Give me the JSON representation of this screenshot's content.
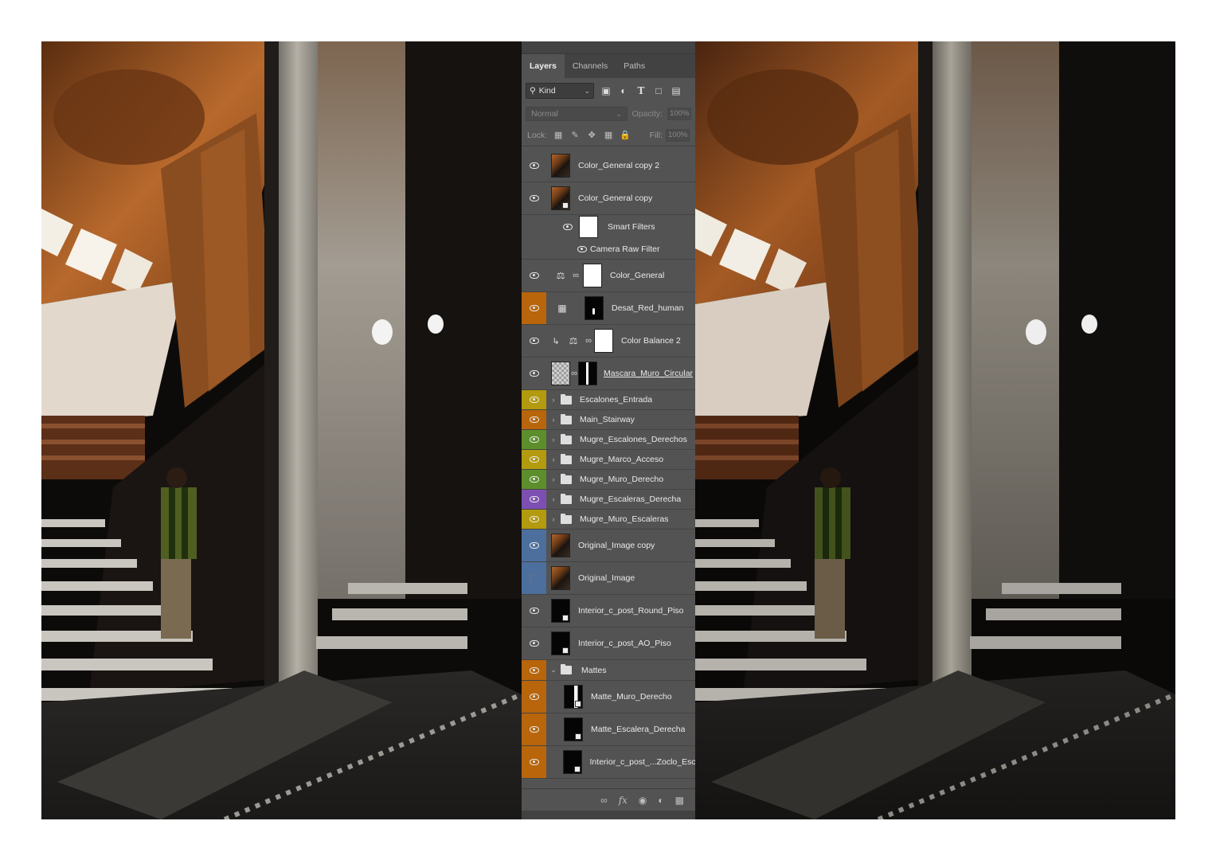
{
  "panel": {
    "tabs": [
      {
        "label": "Layers",
        "active": true
      },
      {
        "label": "Channels",
        "active": false
      },
      {
        "label": "Paths",
        "active": false
      }
    ],
    "filter": {
      "kind_label": "Kind",
      "icons": [
        "image-filter-icon",
        "adjustment-filter-icon",
        "type-filter-icon",
        "shape-filter-icon",
        "smart-object-filter-icon"
      ]
    },
    "blend_mode": "Normal",
    "opacity_label": "Opacity:",
    "opacity_value": "100%",
    "lock_label": "Lock:",
    "fill_label": "Fill:",
    "fill_value": "100%",
    "colors": {
      "orange": "#b8650b",
      "yellow": "#b39a0e",
      "green": "#5c8f2b",
      "purple": "#7d4fb3",
      "blue": "#4d6f9e",
      "panel": "#535353"
    }
  },
  "layers": [
    {
      "name": "Color_General copy 2",
      "kind": "smart"
    },
    {
      "name": "Color_General copy",
      "kind": "smart"
    },
    {
      "name": "Smart Filters",
      "kind": "smart-filters"
    },
    {
      "name": "Camera Raw Filter",
      "kind": "filter"
    },
    {
      "name": "Color_General",
      "kind": "adjustment"
    },
    {
      "name": "Desat_Red_human",
      "kind": "adjustment",
      "color": "orange"
    },
    {
      "name": "Color Balance 2",
      "kind": "adjustment-clipped"
    },
    {
      "name": "Mascara_Muro_Circular",
      "kind": "masked"
    },
    {
      "name": "Escalones_Entrada",
      "kind": "group",
      "color": "yellow"
    },
    {
      "name": "Main_Stairway",
      "kind": "group",
      "color": "orange"
    },
    {
      "name": "Mugre_Escalones_Derechos",
      "kind": "group",
      "color": "green"
    },
    {
      "name": "Mugre_Marco_Acceso",
      "kind": "group",
      "color": "yellow"
    },
    {
      "name": "Mugre_Muro_Derecho",
      "kind": "group",
      "color": "green"
    },
    {
      "name": "Mugre_Escaleras_Derecha",
      "kind": "group",
      "color": "purple"
    },
    {
      "name": "Mugre_Muro_Escaleras",
      "kind": "group",
      "color": "yellow"
    },
    {
      "name": "Original_Image copy",
      "kind": "smart",
      "color": "blue"
    },
    {
      "name": "Original_Image",
      "kind": "smart",
      "color": "blue",
      "hidden": true
    },
    {
      "name": "Interior_c_post_Round_Piso",
      "kind": "smart"
    },
    {
      "name": "Interior_c_post_AO_Piso",
      "kind": "smart"
    },
    {
      "name": "Mattes",
      "kind": "group-open",
      "color": "orange"
    },
    {
      "name": "Matte_Muro_Derecho",
      "kind": "smart-child",
      "color": "orange"
    },
    {
      "name": "Matte_Escalera_Derecha",
      "kind": "smart-child",
      "color": "orange"
    },
    {
      "name": "Interior_c_post_...Zoclo_Esca",
      "kind": "smart-child",
      "color": "orange"
    }
  ],
  "bottom_bar": [
    "link-layers-icon",
    "fx-icon",
    "add-mask-icon",
    "new-adjustment-icon",
    "new-group-icon"
  ]
}
